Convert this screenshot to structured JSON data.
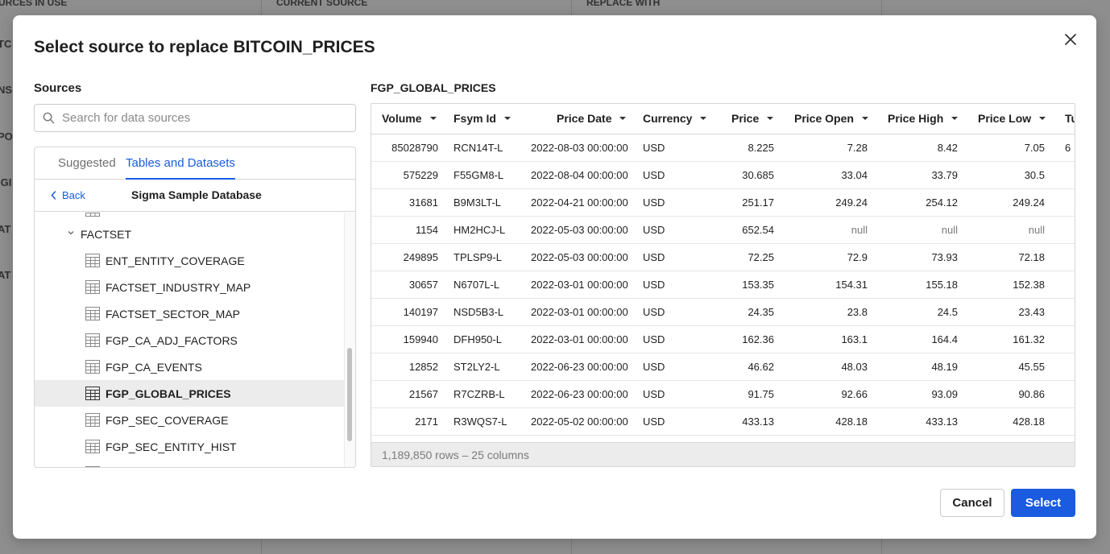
{
  "background": {
    "headers": [
      "URCES IN USE",
      "CURRENT SOURCE",
      "REPLACE WITH"
    ],
    "side_fragments": [
      "TC",
      "NS",
      "PO",
      "IGI",
      "AT",
      "AT"
    ]
  },
  "modal": {
    "title": "Select source to replace BITCOIN_PRICES",
    "close_icon": "close-icon",
    "sources_label": "Sources",
    "search": {
      "placeholder": "Search for data sources",
      "value": ""
    },
    "tabs": [
      {
        "label": "Suggested",
        "active": false
      },
      {
        "label": "Tables and Datasets",
        "active": true
      }
    ],
    "back_label": "Back",
    "database_title": "Sigma Sample Database",
    "tree": {
      "folder": "FACTSET",
      "items": [
        {
          "label": "ENT_ENTITY_COVERAGE",
          "selected": false
        },
        {
          "label": "FACTSET_INDUSTRY_MAP",
          "selected": false
        },
        {
          "label": "FACTSET_SECTOR_MAP",
          "selected": false
        },
        {
          "label": "FGP_CA_ADJ_FACTORS",
          "selected": false
        },
        {
          "label": "FGP_CA_EVENTS",
          "selected": false
        },
        {
          "label": "FGP_GLOBAL_PRICES",
          "selected": true
        },
        {
          "label": "FGP_SEC_COVERAGE",
          "selected": false
        },
        {
          "label": "FGP_SEC_ENTITY_HIST",
          "selected": false
        }
      ]
    },
    "preview": {
      "title": "FGP_GLOBAL_PRICES",
      "columns": [
        "Volume",
        "Fsym Id",
        "Price Date",
        "Currency",
        "Price",
        "Price Open",
        "Price High",
        "Price Low",
        "Tu"
      ],
      "rows": [
        [
          "85028790",
          "RCN14T-L",
          "2022-08-03 00:00:00",
          "USD",
          "8.225",
          "7.28",
          "8.42",
          "7.05",
          "6"
        ],
        [
          "575229",
          "F55GM8-L",
          "2022-08-04 00:00:00",
          "USD",
          "30.685",
          "33.04",
          "33.79",
          "30.5",
          ""
        ],
        [
          "31681",
          "B9M3LT-L",
          "2022-04-21 00:00:00",
          "USD",
          "251.17",
          "249.24",
          "254.12",
          "249.24",
          ""
        ],
        [
          "1154",
          "HM2HCJ-L",
          "2022-05-03 00:00:00",
          "USD",
          "652.54",
          "null",
          "null",
          "null",
          ""
        ],
        [
          "249895",
          "TPLSP9-L",
          "2022-05-03 00:00:00",
          "USD",
          "72.25",
          "72.9",
          "73.93",
          "72.18",
          ""
        ],
        [
          "30657",
          "N6707L-L",
          "2022-03-01 00:00:00",
          "USD",
          "153.35",
          "154.31",
          "155.18",
          "152.38",
          ""
        ],
        [
          "140197",
          "NSD5B3-L",
          "2022-03-01 00:00:00",
          "USD",
          "24.35",
          "23.8",
          "24.5",
          "23.43",
          ""
        ],
        [
          "159940",
          "DFH950-L",
          "2022-03-01 00:00:00",
          "USD",
          "162.36",
          "163.1",
          "164.4",
          "161.32",
          ""
        ],
        [
          "12852",
          "ST2LY2-L",
          "2022-06-23 00:00:00",
          "USD",
          "46.62",
          "48.03",
          "48.19",
          "45.55",
          ""
        ],
        [
          "21567",
          "R7CZRB-L",
          "2022-06-23 00:00:00",
          "USD",
          "91.75",
          "92.66",
          "93.09",
          "90.86",
          ""
        ],
        [
          "2171",
          "R3WQS7-L",
          "2022-05-02 00:00:00",
          "USD",
          "433.13",
          "428.18",
          "433.13",
          "428.18",
          ""
        ]
      ],
      "footer": "1,189,850 rows – 25 columns"
    },
    "buttons": {
      "cancel": "Cancel",
      "select": "Select"
    },
    "colors": {
      "accent": "#1a5be0"
    }
  }
}
